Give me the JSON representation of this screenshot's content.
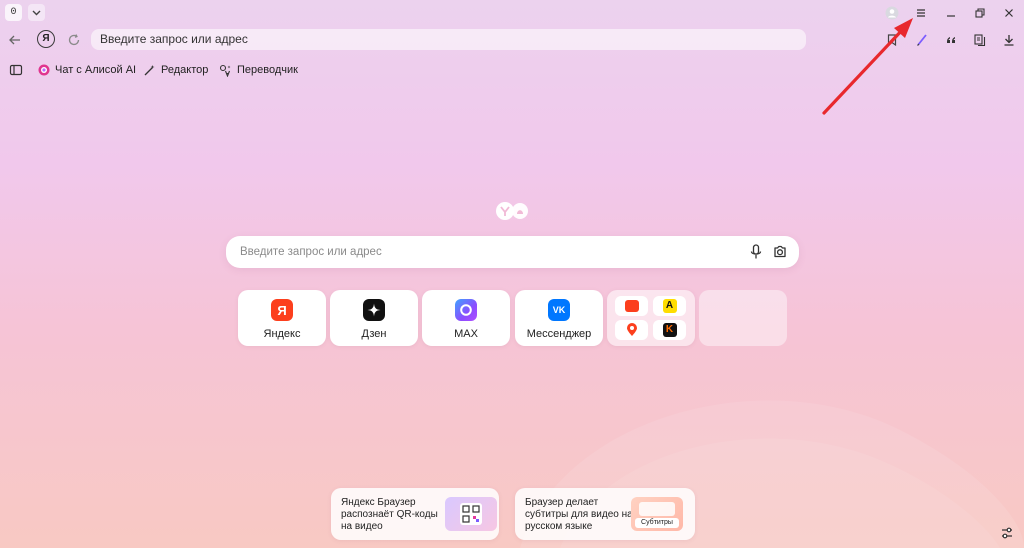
{
  "browser": {
    "tab_counter": "0",
    "address_placeholder": "Введите запрос или адрес"
  },
  "bookmarks": [
    {
      "label": "Чат с Алисой AI",
      "icon": "alice-icon"
    },
    {
      "label": "Редактор",
      "icon": "pen-sparkle-icon"
    },
    {
      "label": "Переводчик",
      "icon": "translate-icon"
    }
  ],
  "search": {
    "placeholder": "Введите запрос или адрес"
  },
  "tiles": [
    {
      "label": "Яндекс",
      "icon": "yandex-icon",
      "color": "#fc3f1d"
    },
    {
      "label": "Дзен",
      "icon": "dzen-icon",
      "color": "#111111"
    },
    {
      "label": "MAX",
      "icon": "max-icon",
      "color": "#6b5cf6"
    },
    {
      "label": "Мессенджер",
      "icon": "vk-icon",
      "color": "#0077ff"
    }
  ],
  "promos": [
    {
      "text": [
        "Яндекс Браузер",
        "распознаёт QR-коды",
        "на видео"
      ],
      "icon": "qr-code-icon"
    },
    {
      "text": [
        "Браузер делает",
        "субтитры для видео на",
        "русском языке"
      ],
      "badge": "Субтитры",
      "icon": "subtitles-icon"
    }
  ],
  "colors": {
    "accent_red": "#e8282d",
    "yandex_red": "#fc3f1d"
  }
}
